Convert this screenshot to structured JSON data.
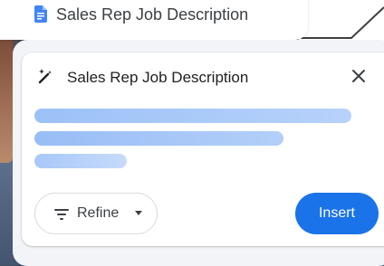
{
  "doc_chip": {
    "title": "Sales Rep Job Description",
    "icon": "google-docs-icon"
  },
  "card": {
    "title": "Sales Rep Job Description",
    "leading_icon": "magic-wand-icon",
    "close_icon": "close-icon",
    "loading_lines": 3,
    "refine_label": "Refine",
    "refine_icon": "filter-icon",
    "refine_caret": "caret-down-icon",
    "insert_label": "Insert"
  },
  "colors": {
    "accent": "#1a73e8",
    "docs_blue": "#4285f4",
    "shimmer": "#a8c8f8"
  }
}
